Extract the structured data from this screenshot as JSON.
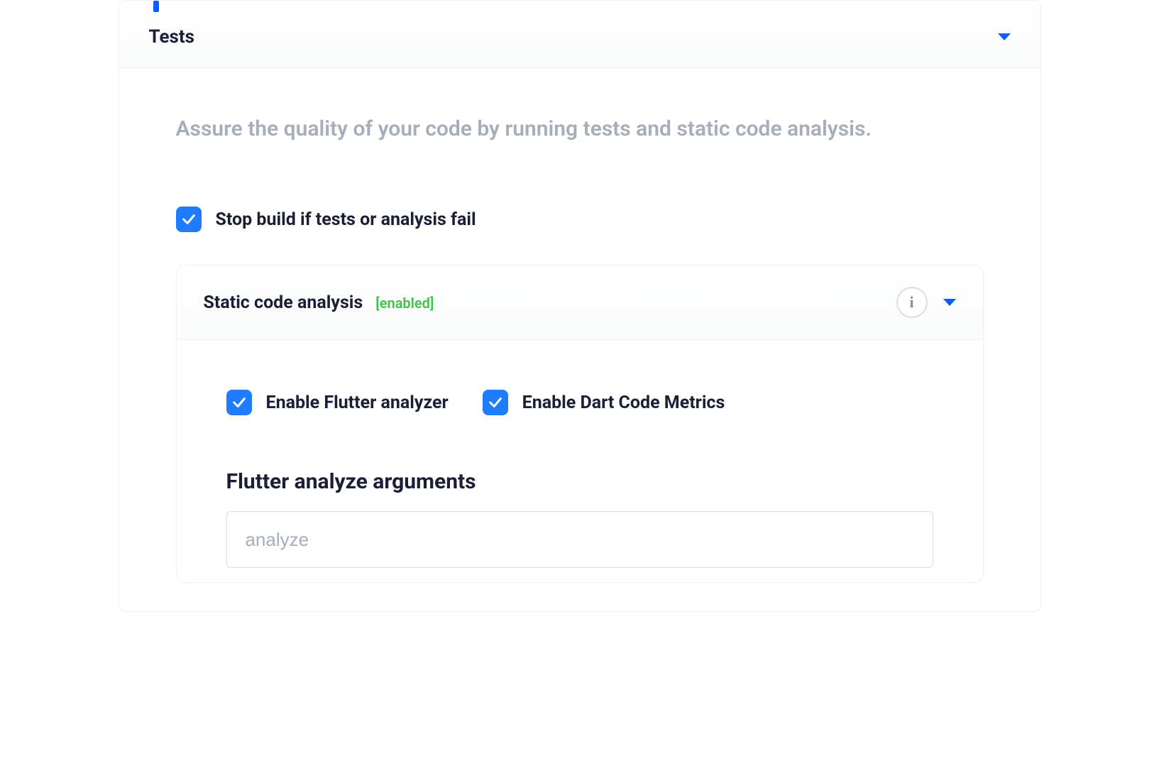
{
  "panel": {
    "title": "Tests",
    "description": "Assure the quality of your code by running tests and static code analysis."
  },
  "options": {
    "stop_build_label": "Stop build if tests or analysis fail"
  },
  "static_analysis": {
    "title": "Static code analysis",
    "status": "[enabled]",
    "enable_flutter_analyzer_label": "Enable Flutter analyzer",
    "enable_dart_code_metrics_label": "Enable Dart Code Metrics",
    "flutter_args_label": "Flutter analyze arguments",
    "flutter_args_placeholder": "analyze",
    "flutter_args_value": ""
  }
}
